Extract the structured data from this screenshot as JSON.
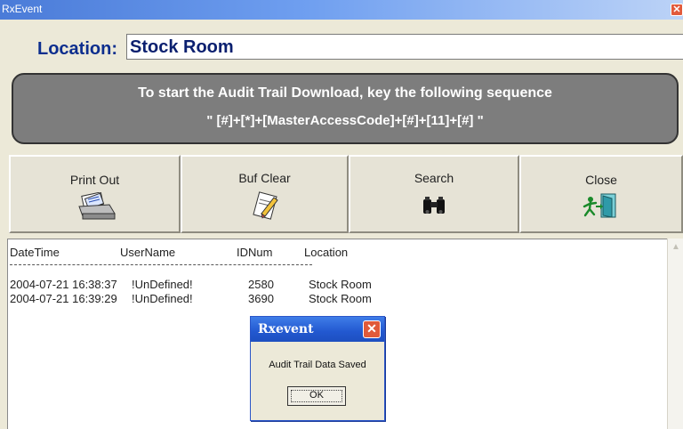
{
  "window": {
    "title": "RxEvent",
    "close_icon": "close-icon"
  },
  "location": {
    "label": "Location:",
    "value": "Stock Room"
  },
  "banner": {
    "line1": "To start the Audit Trail Download, key the following sequence",
    "line2": "\" [#]+[*]+[MasterAccessCode]+[#]+[11]+[#] \""
  },
  "toolbar": {
    "print_label": "Print Out",
    "buf_clear_label": "Buf Clear",
    "search_label": "Search",
    "close_label": "Close"
  },
  "log": {
    "headers": [
      "DateTime",
      "UserName",
      "IDNum",
      "Location"
    ],
    "divider": "--------------------------------------------------------------------------------",
    "rows": [
      {
        "datetime": "2004-07-21 16:38:37",
        "username": "!UnDefined!",
        "idnum": "2580",
        "location": "Stock Room"
      },
      {
        "datetime": "2004-07-21 16:39:29",
        "username": "!UnDefined!",
        "idnum": "3690",
        "location": "Stock Room"
      }
    ]
  },
  "dialog": {
    "title": "Rxevent",
    "message": "Audit Trail Data Saved",
    "ok_label": "OK"
  },
  "colors": {
    "titlebar": "#4a7bd8",
    "location_text": "#0d2e8e",
    "banner_bg": "#7d7d7d",
    "dialog_title": "#2258d0",
    "close_red": "#e25a3b"
  }
}
